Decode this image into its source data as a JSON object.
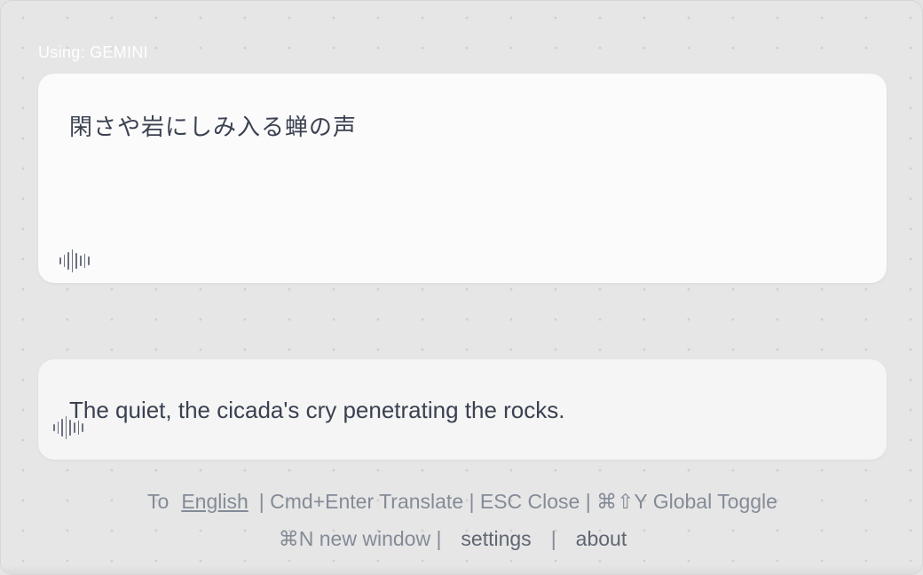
{
  "engine": {
    "label": "Using: GEMINI"
  },
  "source": {
    "text": "閑さや岩にしみ入る蝉の声",
    "speak_icon": "waveform-icon"
  },
  "target": {
    "text": "The quiet, the cicada's cry penetrating the rocks.",
    "speak_icon": "waveform-icon"
  },
  "footer": {
    "to_label": "To",
    "language": "English",
    "shortcuts_text": "| Cmd+Enter Translate | ESC Close | ⌘⇧Y Global Toggle",
    "new_window": "⌘N new window |",
    "settings": "settings",
    "separator": "|",
    "about": "about"
  }
}
